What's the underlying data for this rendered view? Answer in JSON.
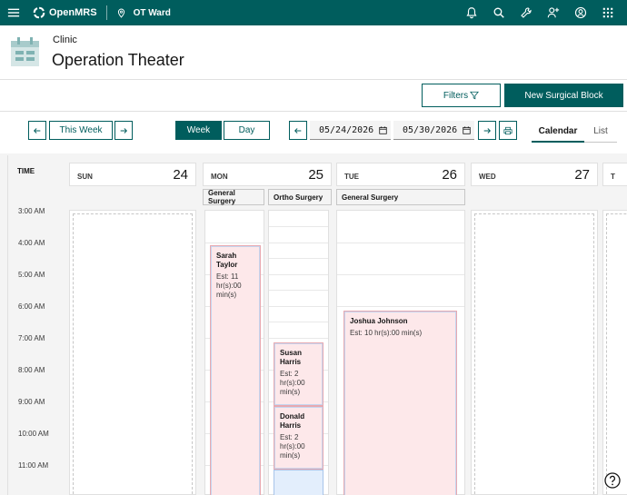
{
  "topbar": {
    "brand": "OpenMRS",
    "location": "OT Ward",
    "icons": [
      "bell-icon",
      "search-icon",
      "tools-icon",
      "user-add-icon",
      "user-avatar-icon",
      "app-switcher-icon"
    ]
  },
  "header": {
    "clinic": "Clinic",
    "title": "Operation Theater"
  },
  "actions": {
    "filters_label": "Filters",
    "new_block_label": "New Surgical Block"
  },
  "nav": {
    "this_week": "This Week",
    "week": "Week",
    "day": "Day",
    "start_date": "05/24/2026",
    "end_date": "05/30/2026",
    "tabs": {
      "calendar": "Calendar",
      "list": "List"
    }
  },
  "calendar": {
    "time_label": "TIME",
    "times": [
      "3:00 AM",
      "4:00 AM",
      "5:00 AM",
      "6:00 AM",
      "7:00 AM",
      "8:00 AM",
      "9:00 AM",
      "10:00 AM",
      "11:00 AM"
    ],
    "days": [
      {
        "name": "SUN",
        "date": "24"
      },
      {
        "name": "MON",
        "date": "25"
      },
      {
        "name": "TUE",
        "date": "26"
      },
      {
        "name": "WED",
        "date": "27"
      },
      {
        "name": "T",
        "date": ""
      }
    ],
    "blocks": {
      "mon_general": "General Surgery",
      "mon_ortho": "Ortho Surgery",
      "tue_general": "General Surgery"
    },
    "events": {
      "sarah": {
        "name": "Sarah Taylor",
        "est": "Est: 11 hr(s):00 min(s)"
      },
      "susan": {
        "name": "Susan Harris",
        "est": "Est: 2 hr(s):00 min(s)"
      },
      "donald": {
        "name": "Donald Harris",
        "est": "Est: 2 hr(s):00 min(s)"
      },
      "joshua": {
        "name": "Joshua Johnson",
        "est": "Est: 10 hr(s):00 min(s)"
      }
    }
  },
  "colors": {
    "brand": "#005d5d",
    "event_bg": "#fde8ea",
    "free_slot": "#e3eefc"
  }
}
